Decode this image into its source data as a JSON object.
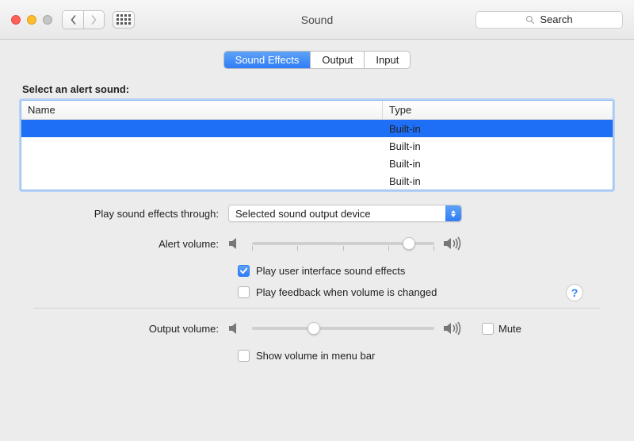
{
  "window": {
    "title": "Sound",
    "search_placeholder": "Search"
  },
  "tabs": [
    {
      "label": "Sound Effects",
      "active": true
    },
    {
      "label": "Output",
      "active": false
    },
    {
      "label": "Input",
      "active": false
    }
  ],
  "alert_table": {
    "title": "Select an alert sound:",
    "columns": [
      "Name",
      "Type"
    ],
    "rows": [
      {
        "name": "",
        "type": "Built-in",
        "selected": true
      },
      {
        "name": "",
        "type": "Built-in",
        "selected": false
      },
      {
        "name": "",
        "type": "Built-in",
        "selected": false
      },
      {
        "name": "",
        "type": "Built-in",
        "selected": false
      }
    ]
  },
  "play_through": {
    "label": "Play sound effects through:",
    "value": "Selected sound output device"
  },
  "alert_volume": {
    "label": "Alert volume:",
    "value_pct": 86
  },
  "checkboxes": {
    "ui_sounds": {
      "label": "Play user interface sound effects",
      "checked": true
    },
    "feedback": {
      "label": "Play feedback when volume is changed",
      "checked": false
    },
    "menu_bar": {
      "label": "Show volume in menu bar",
      "checked": false
    }
  },
  "output_volume": {
    "label": "Output volume:",
    "value_pct": 34,
    "mute_label": "Mute",
    "mute_checked": false
  },
  "help_label": "?"
}
